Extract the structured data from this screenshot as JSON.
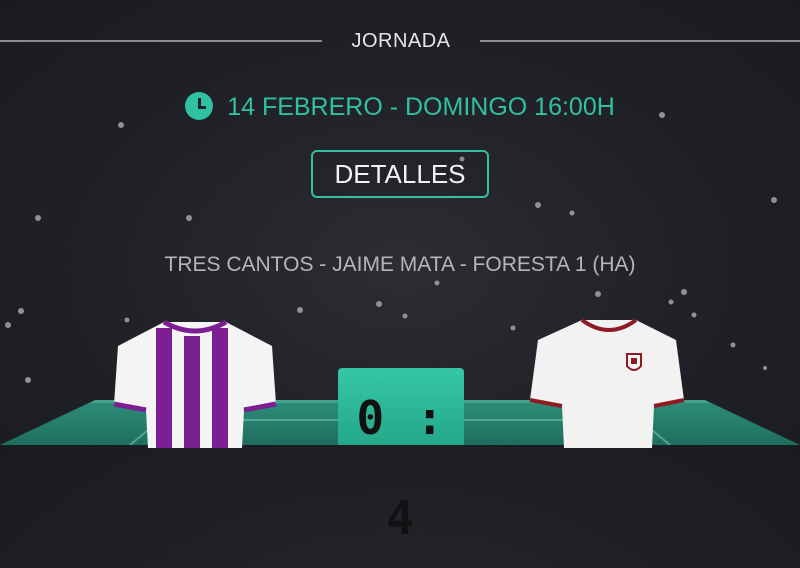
{
  "header": {
    "title": "JORNADA"
  },
  "match": {
    "datetime": "14 FEBRERO - DOMINGO 16:00H",
    "details_label": "DETALLES",
    "venue": "TRES CANTOS - JAIME MATA - FORESTA 1 (HA)",
    "score": "0 : 4"
  },
  "icons": {
    "clock": "clock-icon",
    "home_jersey": "jersey-icon",
    "away_jersey": "jersey-icon"
  },
  "colors": {
    "accent": "#2fc1a0",
    "home_jersey_stripe": "#7b1f93",
    "away_jersey_trim": "#8e1b23"
  }
}
